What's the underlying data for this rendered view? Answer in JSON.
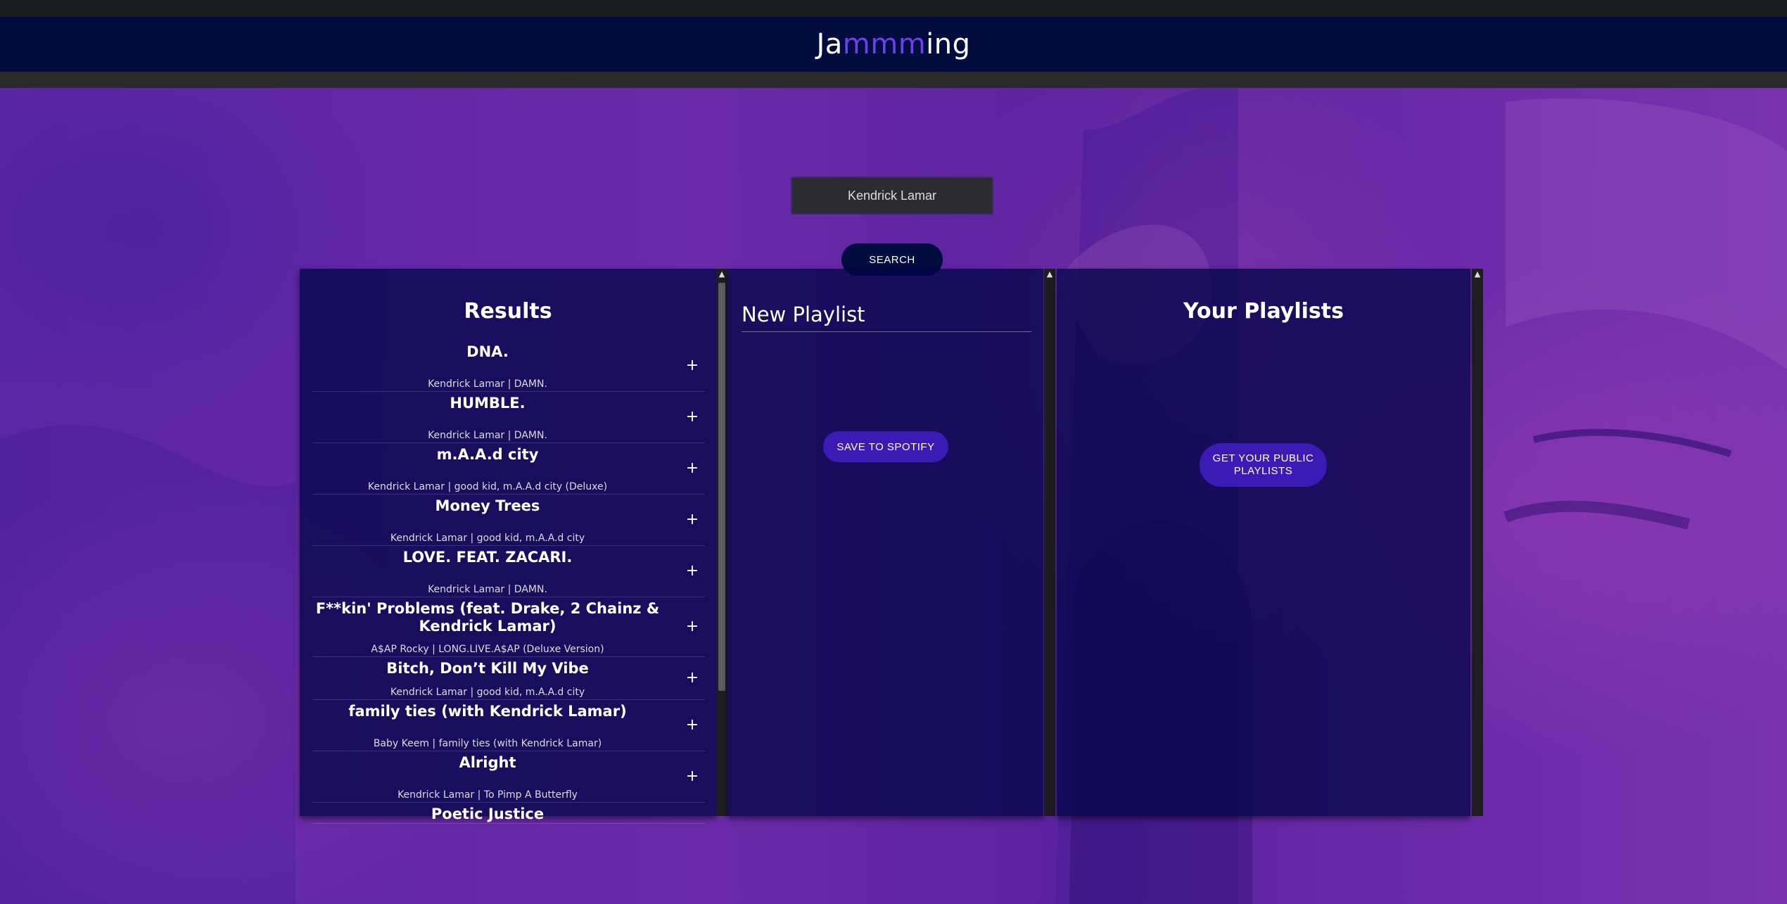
{
  "app": {
    "title_prefix": "Ja",
    "title_accent": "mmm",
    "title_suffix": "ing"
  },
  "search": {
    "value": "Kendrick Lamar",
    "button_label": "SEARCH"
  },
  "results": {
    "title": "Results",
    "add_symbol": "+",
    "tracks": [
      {
        "name": "DNA.",
        "info": "Kendrick Lamar | DAMN."
      },
      {
        "name": "HUMBLE.",
        "info": "Kendrick Lamar | DAMN."
      },
      {
        "name": "m.A.A.d city",
        "info": "Kendrick Lamar | good kid, m.A.A.d city (Deluxe)"
      },
      {
        "name": "Money Trees",
        "info": "Kendrick Lamar | good kid, m.A.A.d city"
      },
      {
        "name": "LOVE. FEAT. ZACARI.",
        "info": "Kendrick Lamar | DAMN."
      },
      {
        "name": "F**kin' Problems (feat. Drake, 2 Chainz & Kendrick Lamar)",
        "info": "A$AP Rocky | LONG.LIVE.A$AP (Deluxe Version)"
      },
      {
        "name": "Bitch, Don’t Kill My Vibe",
        "info": "Kendrick Lamar | good kid, m.A.A.d city"
      },
      {
        "name": "family ties (with Kendrick Lamar)",
        "info": "Baby Keem | family ties (with Kendrick Lamar)"
      },
      {
        "name": "Alright",
        "info": "Kendrick Lamar | To Pimp A Butterfly"
      },
      {
        "name": "Poetic Justice",
        "info": ""
      }
    ]
  },
  "playlist": {
    "name_value": "New Playlist",
    "save_label": "SAVE TO SPOTIFY"
  },
  "your_playlists": {
    "title": "Your Playlists",
    "button_label": "GET YOUR PUBLIC PLAYLISTS"
  },
  "colors": {
    "header_bg": "#010c3f",
    "accent": "#6c41ec",
    "button": "#3c1ab5",
    "background": "#5a1fa8"
  }
}
